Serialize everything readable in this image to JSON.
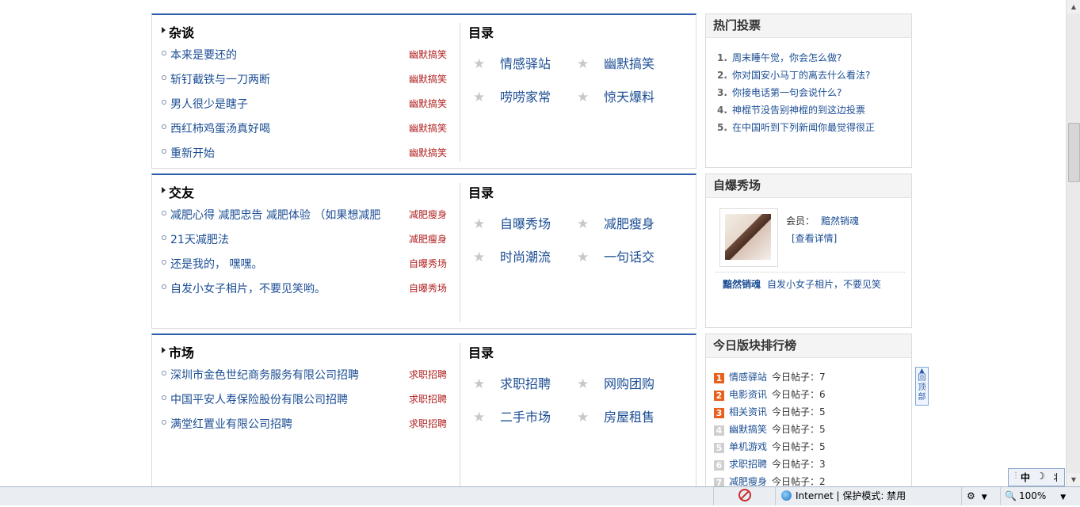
{
  "sections": [
    {
      "title": "杂谈",
      "dir_title": "目录",
      "topics": [
        {
          "text": "本来是要还的",
          "category": "幽默搞笑"
        },
        {
          "text": "斩钉截铁与一刀两断",
          "category": "幽默搞笑"
        },
        {
          "text": "男人很少是瞎子",
          "category": "幽默搞笑"
        },
        {
          "text": "西红柿鸡蛋汤真好喝",
          "category": "幽默搞笑"
        },
        {
          "text": "重新开始",
          "category": "幽默搞笑"
        }
      ],
      "dirs": [
        "情感驿站",
        "幽默搞笑",
        "唠唠家常",
        "惊天爆料"
      ]
    },
    {
      "title": "交友",
      "dir_title": "目录",
      "topics": [
        {
          "text": "减肥心得  减肥忠告  减肥体验  （如果想减肥",
          "category": "减肥瘦身"
        },
        {
          "text": "21天减肥法",
          "category": "减肥瘦身"
        },
        {
          "text": "还是我的， 嘿嘿。",
          "category": "自曝秀场"
        },
        {
          "text": "自发小女子相片，不要见笑哟。",
          "category": "自曝秀场"
        }
      ],
      "dirs": [
        "自曝秀场",
        "减肥瘦身",
        "时尚潮流",
        "一句话交"
      ]
    },
    {
      "title": "市场",
      "dir_title": "目录",
      "topics": [
        {
          "text": "深圳市金色世纪商务服务有限公司招聘",
          "category": "求职招聘"
        },
        {
          "text": "中国平安人寿保险股份有限公司招聘",
          "category": "求职招聘"
        },
        {
          "text": "满堂红置业有限公司招聘",
          "category": "求职招聘"
        }
      ],
      "dirs": [
        "求职招聘",
        "网购团购",
        "二手市场",
        "房屋租售"
      ]
    }
  ],
  "hot_votes": {
    "title": "热门投票",
    "items": [
      {
        "num": "1.",
        "text": "周末睡午觉，你会怎么做?"
      },
      {
        "num": "2.",
        "text": "你对国安小马丁的离去什么看法?"
      },
      {
        "num": "3.",
        "text": "你接电话第一句会说什么?"
      },
      {
        "num": "4.",
        "text": "神棍节没告别神棍的到这边投票"
      },
      {
        "num": "5.",
        "text": "在中国听到下列新闻你最觉得很正"
      }
    ]
  },
  "self_show": {
    "title": "自爆秀场",
    "member_label": "会员：",
    "member_name": "黯然销魂",
    "detail_link": "[查看详情]",
    "post_user": "黯然销魂",
    "post_text": "自发小女子相片，不要见笑"
  },
  "ranking": {
    "title": "今日版块排行榜",
    "count_label": "今日帖子：",
    "items": [
      {
        "rank": "1",
        "board": "情感驿站",
        "count": "7"
      },
      {
        "rank": "2",
        "board": "电影资讯",
        "count": "6"
      },
      {
        "rank": "3",
        "board": "相关资讯",
        "count": "5"
      },
      {
        "rank": "4",
        "board": "幽默搞笑",
        "count": "5"
      },
      {
        "rank": "5",
        "board": "单机游戏",
        "count": "5"
      },
      {
        "rank": "6",
        "board": "求职招聘",
        "count": "3"
      },
      {
        "rank": "7",
        "board": "减肥瘦身",
        "count": "2"
      }
    ]
  },
  "back_to_top": "回顶部",
  "ime": {
    "lang": "中",
    "moon": "☽",
    "mode": "丬"
  },
  "statusbar": {
    "zone": "Internet | 保护模式: 禁用",
    "zoom": "100%"
  }
}
